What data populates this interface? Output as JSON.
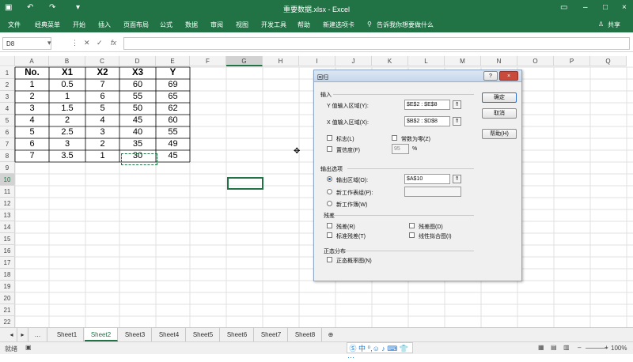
{
  "titlebar": {
    "title": "重要数据.xlsx - Excel",
    "user_icon": "person-icon"
  },
  "ribbon": {
    "tabs": [
      "文件",
      "经典菜单",
      "开始",
      "插入",
      "页面布局",
      "公式",
      "数据",
      "审阅",
      "视图",
      "开发工具",
      "帮助",
      "新建选项卡"
    ],
    "tell_me": "告诉我你想要做什么",
    "share": "共享"
  },
  "formula": {
    "name_box": "D8",
    "fx": "fx"
  },
  "columns": [
    "A",
    "B",
    "C",
    "D",
    "E",
    "F",
    "G",
    "H",
    "I",
    "J",
    "K",
    "L",
    "M",
    "N",
    "O",
    "P",
    "Q"
  ],
  "rows": [
    "1",
    "2",
    "3",
    "4",
    "5",
    "6",
    "7",
    "8",
    "9",
    "10",
    "11",
    "12",
    "13",
    "14",
    "15",
    "16",
    "17",
    "18",
    "19",
    "20",
    "21",
    "22"
  ],
  "table": {
    "headers": [
      "No.",
      "X1",
      "X2",
      "X3",
      "Y"
    ],
    "rows": [
      [
        "1",
        "0.5",
        "7",
        "60",
        "69"
      ],
      [
        "2",
        "1",
        "6",
        "55",
        "65"
      ],
      [
        "3",
        "1.5",
        "5",
        "50",
        "62"
      ],
      [
        "4",
        "2",
        "4",
        "45",
        "60"
      ],
      [
        "5",
        "2.5",
        "3",
        "40",
        "55"
      ],
      [
        "6",
        "3",
        "2",
        "35",
        "49"
      ],
      [
        "7",
        "3.5",
        "1",
        "30",
        "45"
      ]
    ]
  },
  "sheets": [
    "Sheet1",
    "Sheet2",
    "Sheet3",
    "Sheet4",
    "Sheet5",
    "Sheet6",
    "Sheet7",
    "Sheet8"
  ],
  "active_sheet": "Sheet2",
  "status": {
    "mode": "就绪",
    "zoom": "100%"
  },
  "dialog": {
    "title": "回归",
    "input_section": "输入",
    "y_range_label": "Y 值输入区域(Y):",
    "y_range_value": "$E$2 : $E$8",
    "x_range_label": "X 值输入区域(X):",
    "x_range_value": "$B$2 : $D$8",
    "labels_label": "标志(L)",
    "const_zero_label": "常数为零(Z)",
    "confidence_label": "置信度(F)",
    "confidence_value": "95",
    "percent": "%",
    "output_section": "输出选项",
    "output_range_label": "输出区域(O):",
    "output_range_value": "$A$10",
    "new_worksheet_label": "新工作表组(P):",
    "new_workbook_label": "新工作簿(W)",
    "residuals_section": "残差",
    "residuals_label": "残差(R)",
    "residual_plots_label": "残差图(D)",
    "std_residuals_label": "标准残差(T)",
    "line_fit_label": "线性拟合图(I)",
    "normal_section": "正态分布",
    "normal_plot_label": "正态概率图(N)",
    "ok_label": "确定",
    "cancel_label": "取消",
    "help_label": "帮助(H)",
    "help_glyph": "?",
    "close_glyph": "×"
  },
  "colors": {
    "excel_green": "#217346"
  }
}
